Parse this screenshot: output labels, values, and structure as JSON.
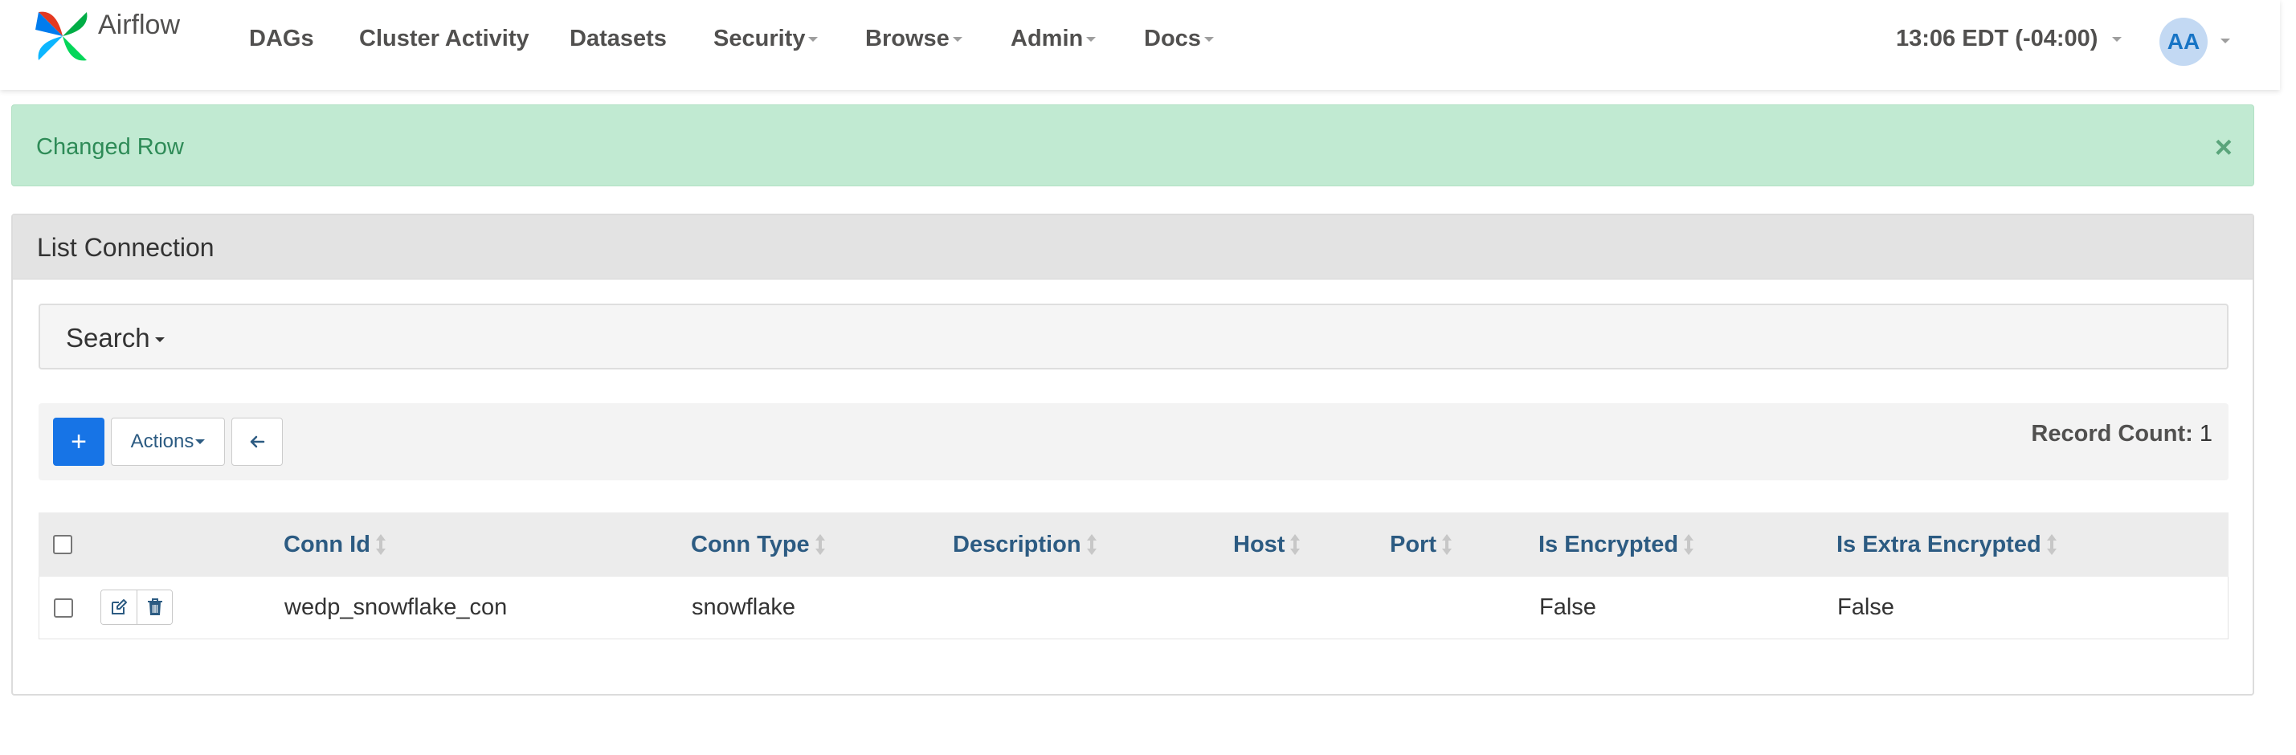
{
  "brand": {
    "name": "Airflow"
  },
  "nav": {
    "items": [
      {
        "label": "DAGs"
      },
      {
        "label": "Cluster Activity"
      },
      {
        "label": "Datasets"
      },
      {
        "label": "Security"
      },
      {
        "label": "Browse"
      },
      {
        "label": "Admin"
      },
      {
        "label": "Docs"
      }
    ],
    "clock": "13:06 EDT (-04:00)",
    "avatar_initials": "AA"
  },
  "alert": {
    "message": "Changed Row",
    "close": "×",
    "color": "#c1ead2"
  },
  "panel": {
    "title": "List Connection",
    "search_label": "Search",
    "toolbar": {
      "add_label": "+",
      "actions_label": "Actions",
      "record_count_label": "Record Count:",
      "record_count_value": "1"
    }
  },
  "table": {
    "columns": [
      "Conn Id",
      "Conn Type",
      "Description",
      "Host",
      "Port",
      "Is Encrypted",
      "Is Extra Encrypted"
    ],
    "rows": [
      {
        "conn_id": "wedp_snowflake_con",
        "conn_type": "snowflake",
        "description": "",
        "host": "",
        "port": "",
        "is_encrypted": "False",
        "is_extra_encrypted": "False"
      }
    ]
  },
  "colors": {
    "primary": "#1774e6",
    "link": "#2c5b82",
    "success_text": "#2e8b57"
  }
}
